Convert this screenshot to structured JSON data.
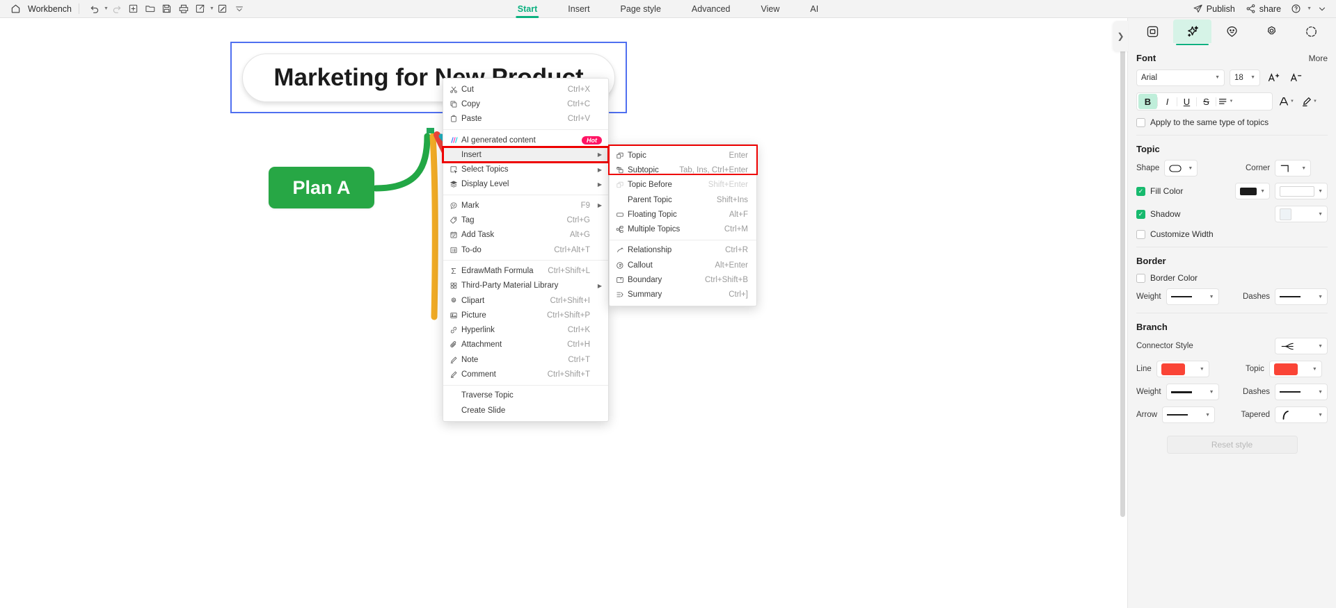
{
  "topbar": {
    "home_label": "Workbench",
    "left_icons": [
      {
        "name": "undo-icon",
        "caret": true
      },
      {
        "name": "redo-icon",
        "caret": false
      },
      {
        "name": "new-icon",
        "caret": false
      },
      {
        "name": "open-folder-icon",
        "caret": false
      },
      {
        "name": "save-icon",
        "caret": false
      },
      {
        "name": "print-icon",
        "caret": false
      },
      {
        "name": "export-share-icon",
        "caret": true
      },
      {
        "name": "edit-box-icon",
        "caret": false
      },
      {
        "name": "more-chevron-icon",
        "caret": false
      }
    ],
    "tabs": [
      {
        "label": "Start",
        "active": true
      },
      {
        "label": "Insert",
        "active": false
      },
      {
        "label": "Page style",
        "active": false
      },
      {
        "label": "Advanced",
        "active": false
      },
      {
        "label": "View",
        "active": false
      },
      {
        "label": "AI",
        "active": false
      }
    ],
    "publish_label": "Publish",
    "share_label": "share",
    "accent_color": "#0cb180"
  },
  "canvas": {
    "central_topic": "Marketing for New Product",
    "branch_node": "Plan A",
    "branch_node_color": "#27a745",
    "selection_color": "#4f6ff0",
    "handle_color": "#22a95a",
    "connector_colors": [
      "#22a95a",
      "#f0ab26",
      "#f0453a",
      "#22b5c4"
    ]
  },
  "context_menu": {
    "items": [
      {
        "icon": "scissors-icon",
        "label": "Cut",
        "shortcut": "Ctrl+X",
        "arrow": false
      },
      {
        "icon": "copy-icon",
        "label": "Copy",
        "shortcut": "Ctrl+C",
        "arrow": false
      },
      {
        "icon": "paste-icon",
        "label": "Paste",
        "shortcut": "Ctrl+V",
        "arrow": false
      },
      {
        "separator": true
      },
      {
        "icon": "ai-sparkle-icon",
        "label": "AI generated content",
        "badge": "Hot",
        "arrow": false
      },
      {
        "icon": null,
        "label": "Insert",
        "shortcut": "",
        "arrow": true,
        "highlighted": true
      },
      {
        "icon": "select-topics-icon",
        "label": "Select Topics",
        "shortcut": "",
        "arrow": true
      },
      {
        "icon": "display-level-icon",
        "label": "Display Level",
        "shortcut": "",
        "arrow": true
      },
      {
        "separator": true
      },
      {
        "icon": "mark-icon",
        "label": "Mark",
        "shortcut": "F9",
        "arrow": true
      },
      {
        "icon": "tag-icon",
        "label": "Tag",
        "shortcut": "Ctrl+G",
        "arrow": false
      },
      {
        "icon": "add-task-icon",
        "label": "Add Task",
        "shortcut": "Alt+G",
        "arrow": false
      },
      {
        "icon": "todo-icon",
        "label": "To-do",
        "shortcut": "Ctrl+Alt+T",
        "arrow": false
      },
      {
        "separator": true
      },
      {
        "icon": "sigma-icon",
        "label": "EdrawMath Formula",
        "shortcut": "Ctrl+Shift+L",
        "arrow": false
      },
      {
        "icon": "material-library-icon",
        "label": "Third-Party Material Library",
        "shortcut": "",
        "arrow": true
      },
      {
        "icon": "clipart-icon",
        "label": "Clipart",
        "shortcut": "Ctrl+Shift+I",
        "arrow": false
      },
      {
        "icon": "picture-icon",
        "label": "Picture",
        "shortcut": "Ctrl+Shift+P",
        "arrow": false
      },
      {
        "icon": "hyperlink-icon",
        "label": "Hyperlink",
        "shortcut": "Ctrl+K",
        "arrow": false
      },
      {
        "icon": "attachment-icon",
        "label": "Attachment",
        "shortcut": "Ctrl+H",
        "arrow": false
      },
      {
        "icon": "note-icon",
        "label": "Note",
        "shortcut": "Ctrl+T",
        "arrow": false
      },
      {
        "icon": "comment-icon",
        "label": "Comment",
        "shortcut": "Ctrl+Shift+T",
        "arrow": false
      },
      {
        "separator": true
      },
      {
        "icon": null,
        "label": "Traverse Topic",
        "shortcut": "",
        "arrow": false
      },
      {
        "icon": null,
        "label": "Create Slide",
        "shortcut": "",
        "arrow": false
      }
    ]
  },
  "submenu": {
    "items": [
      {
        "icon": "topic-icon",
        "label": "Topic",
        "shortcut": "Enter",
        "disabled": false
      },
      {
        "icon": "subtopic-icon",
        "label": "Subtopic",
        "shortcut": "Tab, Ins, Ctrl+Enter",
        "disabled": false
      },
      {
        "icon": "topic-before-icon",
        "label": "Topic Before",
        "shortcut": "Shift+Enter",
        "disabled": true
      },
      {
        "icon": null,
        "label": "Parent Topic",
        "shortcut": "Shift+Ins",
        "disabled": false
      },
      {
        "icon": "floating-topic-icon",
        "label": "Floating Topic",
        "shortcut": "Alt+F",
        "disabled": false
      },
      {
        "icon": "multiple-topics-icon",
        "label": "Multiple Topics",
        "shortcut": "Ctrl+M",
        "disabled": false
      },
      {
        "separator": true
      },
      {
        "icon": "relationship-icon",
        "label": "Relationship",
        "shortcut": "Ctrl+R",
        "disabled": false
      },
      {
        "icon": "callout-icon",
        "label": "Callout",
        "shortcut": "Alt+Enter",
        "disabled": false
      },
      {
        "icon": "boundary-icon",
        "label": "Boundary",
        "shortcut": "Ctrl+Shift+B",
        "disabled": false
      },
      {
        "icon": "summary-icon",
        "label": "Summary",
        "shortcut": "Ctrl+]",
        "disabled": false
      }
    ],
    "highlight_color": "#ee0000"
  },
  "right_panel": {
    "tabs": [
      {
        "name": "shape-style-tab",
        "active": false
      },
      {
        "name": "text-style-tab",
        "active": true
      },
      {
        "name": "theme-tab",
        "active": false
      },
      {
        "name": "badge-tab",
        "active": false
      },
      {
        "name": "history-tab",
        "active": false
      }
    ],
    "font": {
      "section_title": "Font",
      "more_label": "More",
      "family": "Arial",
      "size": "18",
      "increase_label": "A+",
      "decrease_label": "A-",
      "bold_on": true,
      "italic_on": false,
      "underline_on": false,
      "strike_on": false
    },
    "apply_same_type": {
      "label": "Apply to the same type of topics",
      "checked": false
    },
    "topic": {
      "section_title": "Topic",
      "shape_label": "Shape",
      "corner_label": "Corner",
      "fill_color_label": "Fill Color",
      "fill_color_checked": true,
      "fill_swatch": "#1b1b1b",
      "fill_second_swatch": "#ffffff",
      "shadow_label": "Shadow",
      "shadow_checked": true,
      "customize_width_label": "Customize Width",
      "customize_width_checked": false
    },
    "border": {
      "section_title": "Border",
      "border_color_label": "Border Color",
      "border_color_checked": false,
      "weight_label": "Weight",
      "dashes_label": "Dashes"
    },
    "branch": {
      "section_title": "Branch",
      "connector_style_label": "Connector Style",
      "line_label": "Line",
      "line_color": "#fa4436",
      "topic_label": "Topic",
      "topic_color": "#fa4436",
      "weight_label": "Weight",
      "dashes_label": "Dashes",
      "arrow_label": "Arrow",
      "tapered_label": "Tapered"
    },
    "reset_label": "Reset style"
  }
}
